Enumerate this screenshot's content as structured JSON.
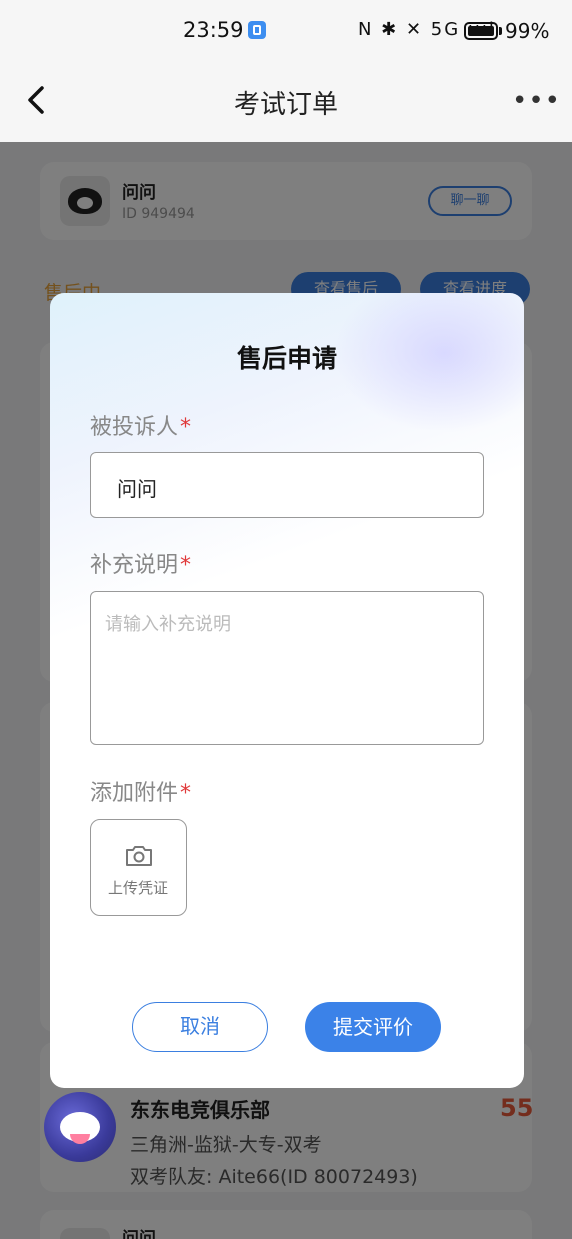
{
  "status_bar": {
    "time": "23:59",
    "icons": "N ✱ ✕ 5G ıııl",
    "battery": "99%"
  },
  "nav": {
    "title": "考试订单"
  },
  "background": {
    "top_card": {
      "name": "问问",
      "id": "ID 949494",
      "chat_button": "聊一聊"
    },
    "section": {
      "status": "售后中",
      "view_aftersale_button": "查看售后",
      "view_progress_button": "查看进度"
    },
    "club_card": {
      "name": "东东电竞俱乐部",
      "line1": "三角洲-监狱-大专-双考",
      "line2": "双考队友: Aite66(ID 80072493)",
      "price": "55"
    },
    "bottom_card": {
      "name": "问问"
    }
  },
  "modal": {
    "title": "售后申请",
    "complainee_label": "被投诉人",
    "complainee_value": "问问",
    "note_label": "补充说明",
    "note_placeholder": "请输入补充说明",
    "attachment_label": "添加附件",
    "upload_label": "上传凭证",
    "required_mark": "*",
    "cancel_button": "取消",
    "submit_button": "提交评价"
  },
  "colors": {
    "accent": "#3b82e8",
    "required": "#e0393a",
    "price": "#e85a3a"
  }
}
